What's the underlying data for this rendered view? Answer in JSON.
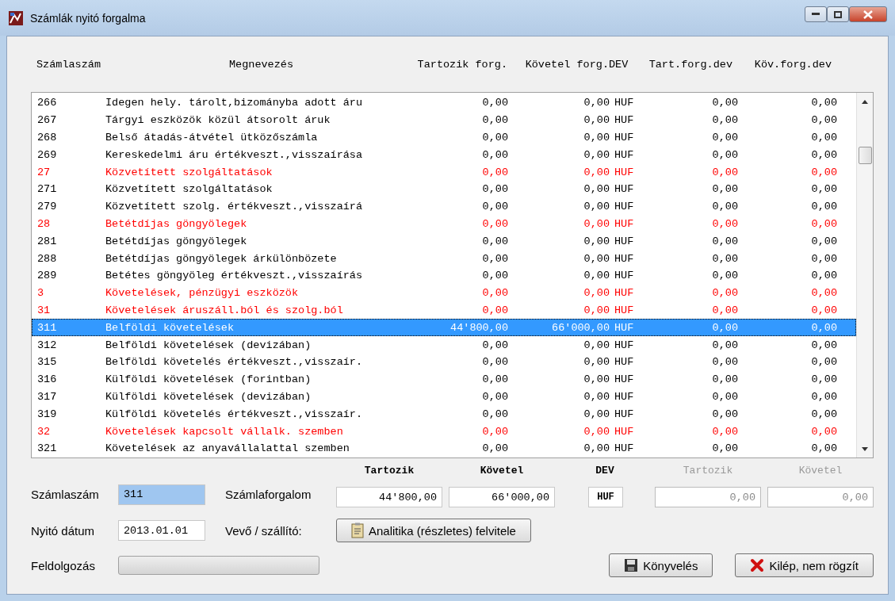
{
  "window": {
    "title": "Számlák nyitó forgalma"
  },
  "table": {
    "columns": [
      "Számlaszám",
      "Megnevezés",
      "Tartozik forg.",
      "Követel forg.",
      "DEV",
      "Tart.forg.dev",
      "Köv.forg.dev"
    ],
    "rows": [
      {
        "kind": "account",
        "selected": false,
        "cells": [
          "266",
          "Idegen hely. tárolt,bizományba adott áru",
          "0,00",
          "0,00",
          "HUF",
          "0,00",
          "0,00"
        ]
      },
      {
        "kind": "account",
        "selected": false,
        "cells": [
          "267",
          "Tárgyi eszközök közül átsorolt áruk",
          "0,00",
          "0,00",
          "HUF",
          "0,00",
          "0,00"
        ]
      },
      {
        "kind": "account",
        "selected": false,
        "cells": [
          "268",
          "Belső átadás-átvétel ütközőszámla",
          "0,00",
          "0,00",
          "HUF",
          "0,00",
          "0,00"
        ]
      },
      {
        "kind": "account",
        "selected": false,
        "cells": [
          "269",
          "Kereskedelmi áru értékveszt.,visszaírása",
          "0,00",
          "0,00",
          "HUF",
          "0,00",
          "0,00"
        ]
      },
      {
        "kind": "group",
        "selected": false,
        "cells": [
          "27",
          "Közvetített szolgáltatások",
          "0,00",
          "0,00",
          "HUF",
          "0,00",
          "0,00"
        ]
      },
      {
        "kind": "account",
        "selected": false,
        "cells": [
          "271",
          "Közvetített szolgáltatások",
          "0,00",
          "0,00",
          "HUF",
          "0,00",
          "0,00"
        ]
      },
      {
        "kind": "account",
        "selected": false,
        "cells": [
          "279",
          "Közvetített szolg. értékveszt.,visszaírá",
          "0,00",
          "0,00",
          "HUF",
          "0,00",
          "0,00"
        ]
      },
      {
        "kind": "group",
        "selected": false,
        "cells": [
          "28",
          "Betétdíjas göngyölegek",
          "0,00",
          "0,00",
          "HUF",
          "0,00",
          "0,00"
        ]
      },
      {
        "kind": "account",
        "selected": false,
        "cells": [
          "281",
          "Betétdíjas göngyölegek",
          "0,00",
          "0,00",
          "HUF",
          "0,00",
          "0,00"
        ]
      },
      {
        "kind": "account",
        "selected": false,
        "cells": [
          "288",
          "Betétdíjas göngyölegek árkülönbözete",
          "0,00",
          "0,00",
          "HUF",
          "0,00",
          "0,00"
        ]
      },
      {
        "kind": "account",
        "selected": false,
        "cells": [
          "289",
          "Betétes göngyöleg értékveszt.,visszaírás",
          "0,00",
          "0,00",
          "HUF",
          "0,00",
          "0,00"
        ]
      },
      {
        "kind": "group",
        "selected": false,
        "cells": [
          "3",
          "Követelések, pénzügyi eszközök",
          "0,00",
          "0,00",
          "HUF",
          "0,00",
          "0,00"
        ]
      },
      {
        "kind": "group",
        "selected": false,
        "cells": [
          "31",
          "Követelések áruszáll.ból és szolg.ból",
          "0,00",
          "0,00",
          "HUF",
          "0,00",
          "0,00"
        ]
      },
      {
        "kind": "account",
        "selected": true,
        "cells": [
          "311",
          "Belföldi követelések",
          "44'800,00",
          "66'000,00",
          "HUF",
          "0,00",
          "0,00"
        ]
      },
      {
        "kind": "account",
        "selected": false,
        "cells": [
          "312",
          "Belföldi követelések (devizában)",
          "0,00",
          "0,00",
          "HUF",
          "0,00",
          "0,00"
        ]
      },
      {
        "kind": "account",
        "selected": false,
        "cells": [
          "315",
          "Belföldi követelés értékveszt.,visszaír.",
          "0,00",
          "0,00",
          "HUF",
          "0,00",
          "0,00"
        ]
      },
      {
        "kind": "account",
        "selected": false,
        "cells": [
          "316",
          "Külföldi követelések (forintban)",
          "0,00",
          "0,00",
          "HUF",
          "0,00",
          "0,00"
        ]
      },
      {
        "kind": "account",
        "selected": false,
        "cells": [
          "317",
          "Külföldi követelések (devizában)",
          "0,00",
          "0,00",
          "HUF",
          "0,00",
          "0,00"
        ]
      },
      {
        "kind": "account",
        "selected": false,
        "cells": [
          "319",
          "Külföldi követelés értékveszt.,visszaír.",
          "0,00",
          "0,00",
          "HUF",
          "0,00",
          "0,00"
        ]
      },
      {
        "kind": "group",
        "selected": false,
        "cells": [
          "32",
          "Követelések kapcsolt vállalk. szemben",
          "0,00",
          "0,00",
          "HUF",
          "0,00",
          "0,00"
        ]
      },
      {
        "kind": "account",
        "selected": false,
        "cells": [
          "321",
          "Követelések az anyavállalattal szemben",
          "0,00",
          "0,00",
          "HUF",
          "0,00",
          "0,00"
        ]
      }
    ]
  },
  "form": {
    "account": {
      "label": "Számlaszám",
      "value": "311",
      "selected": true
    },
    "date": {
      "label": "Nyitó dátum",
      "value": "2013.01.01"
    },
    "turnover": {
      "label": "Számlaforgalom",
      "fields": [
        {
          "kind": "amount",
          "header": "Tartozik",
          "value": "44'800,00",
          "disabled": false
        },
        {
          "kind": "amount",
          "header": "Követel",
          "value": "66'000,00",
          "disabled": false
        },
        {
          "kind": "code",
          "header": "DEV",
          "value": "HUF",
          "disabled": false
        },
        {
          "kind": "amount",
          "header": "Tartozik",
          "value": "0,00",
          "disabled": true
        },
        {
          "kind": "amount",
          "header": "Követel",
          "value": "0,00",
          "disabled": true
        }
      ]
    },
    "partner": {
      "label": "Vevő / szállító:",
      "button": "Analitika (részletes) felvitele"
    },
    "processing": {
      "label": "Feldolgozás",
      "level": 0
    }
  },
  "buttons": [
    {
      "kind": "save",
      "label": "Könyvelés"
    },
    {
      "kind": "cancel",
      "label": "Kilép, nem rögzít"
    }
  ]
}
